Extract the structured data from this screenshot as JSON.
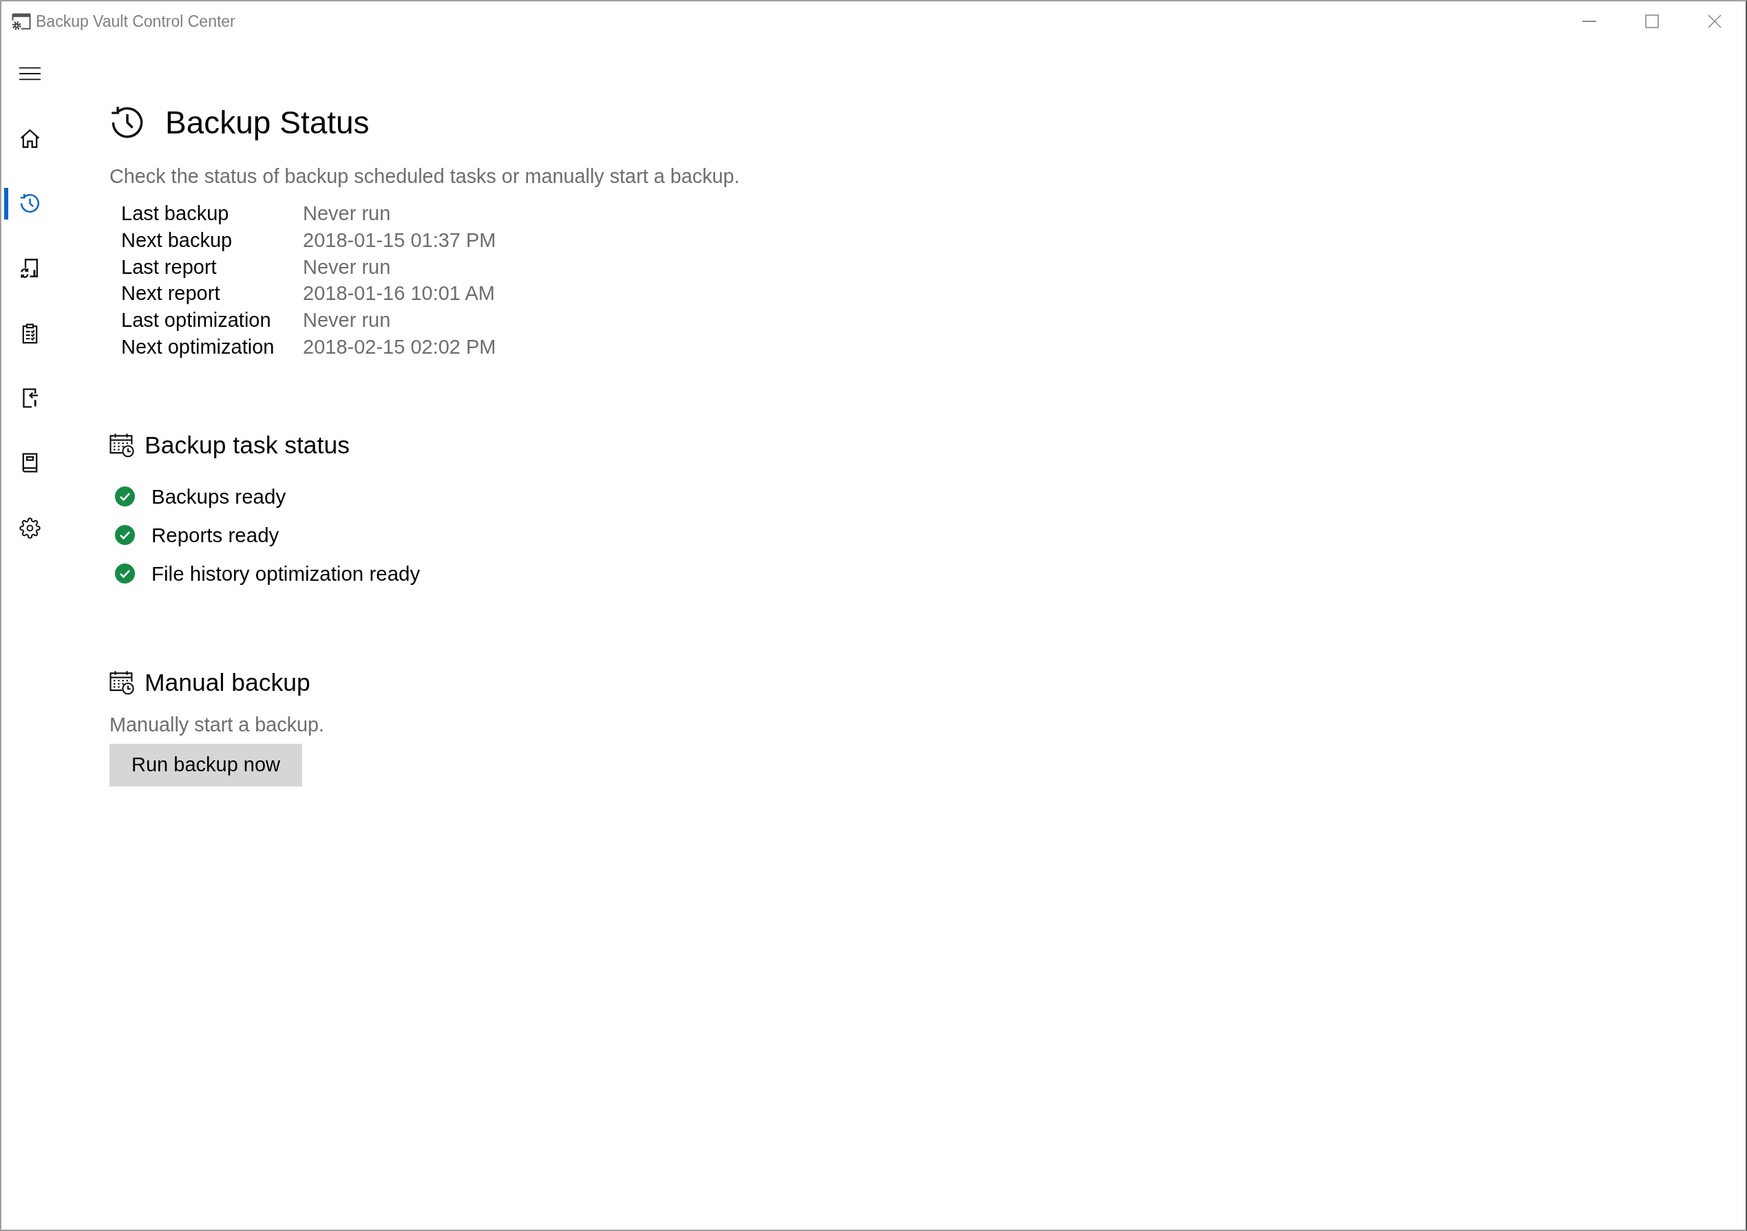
{
  "window": {
    "title": "Backup Vault Control Center"
  },
  "sidebar": {
    "items": [
      {
        "selected": false
      },
      {
        "selected": true
      },
      {
        "selected": false
      },
      {
        "selected": false
      },
      {
        "selected": false
      },
      {
        "selected": false
      },
      {
        "selected": false
      }
    ]
  },
  "header": {
    "title": "Backup Status",
    "description": "Check the status of backup scheduled tasks or manually start a backup."
  },
  "schedule": [
    {
      "label": "Last backup",
      "value": "Never run"
    },
    {
      "label": "Next backup",
      "value": "2018-01-15 01:37 PM"
    },
    {
      "label": "Last report",
      "value": "Never run"
    },
    {
      "label": "Next report",
      "value": "2018-01-16 10:01 AM"
    },
    {
      "label": "Last optimization",
      "value": "Never run"
    },
    {
      "label": "Next optimization",
      "value": "2018-02-15 02:02 PM"
    }
  ],
  "task_status": {
    "title": "Backup task status",
    "items": [
      {
        "label": "Backups ready",
        "ok": true
      },
      {
        "label": "Reports ready",
        "ok": true
      },
      {
        "label": "File history optimization ready",
        "ok": true
      }
    ]
  },
  "manual_backup": {
    "title": "Manual backup",
    "description": "Manually start a backup.",
    "button": "Run backup now"
  }
}
